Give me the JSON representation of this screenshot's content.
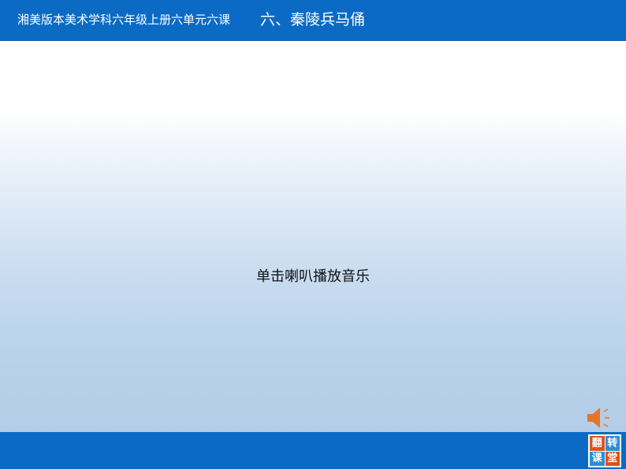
{
  "header": {
    "course_label": "湘美版本美术学科六年级上册六单元六课",
    "lesson_title": "六、秦陵兵马俑"
  },
  "main": {
    "instruction": "单击喇叭播放音乐"
  },
  "audio": {
    "icon": "speaker-icon",
    "icon_color": "#e8742a"
  },
  "logo": {
    "chars": [
      "翻",
      "转",
      "课",
      "堂"
    ]
  },
  "colors": {
    "bar": "#0b6bc4",
    "logo_orange": "#d9531e",
    "logo_blue": "#2a8fd6"
  }
}
